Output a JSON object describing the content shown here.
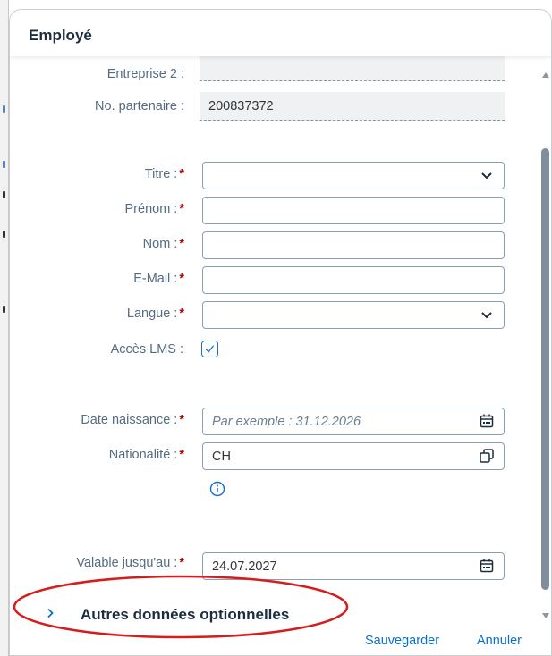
{
  "dialog": {
    "title": "Employé"
  },
  "fields": {
    "company2": {
      "label": "Entreprise 2 :",
      "value": ""
    },
    "partner_no": {
      "label": "No. partenaire :",
      "value": "200837372"
    },
    "title": {
      "label": "Titre :",
      "value": ""
    },
    "first_name": {
      "label": "Prénom :",
      "value": ""
    },
    "last_name": {
      "label": "Nom :",
      "value": ""
    },
    "email": {
      "label": "E-Mail :",
      "value": ""
    },
    "language": {
      "label": "Langue :",
      "value": ""
    },
    "lms_access": {
      "label": "Accès LMS :",
      "checked": true
    },
    "birth_date": {
      "label": "Date naissance :",
      "placeholder": "Par exemple : 31.12.2026"
    },
    "nationality": {
      "label": "Nationalité :",
      "value": "CH"
    },
    "valid_until": {
      "label": "Valable jusqu'au :",
      "value": "24.07.2027"
    }
  },
  "required_marker": "*",
  "optional_section": {
    "label": "Autres données optionnelles",
    "expanded": false
  },
  "footer": {
    "save_label": "Sauvegarder",
    "cancel_label": "Annuler"
  },
  "icons": {
    "dropdown": "chevron-down-icon",
    "calendar": "calendar-icon",
    "value_help": "value-help-icon",
    "info": "info-icon",
    "expand": "chevron-right-icon",
    "checkbox": "checkmark-icon"
  },
  "colors": {
    "accent": "#0a6ed1",
    "required": "#aa0808",
    "label": "#556b82",
    "highlight_ellipse": "#d61c1c"
  }
}
